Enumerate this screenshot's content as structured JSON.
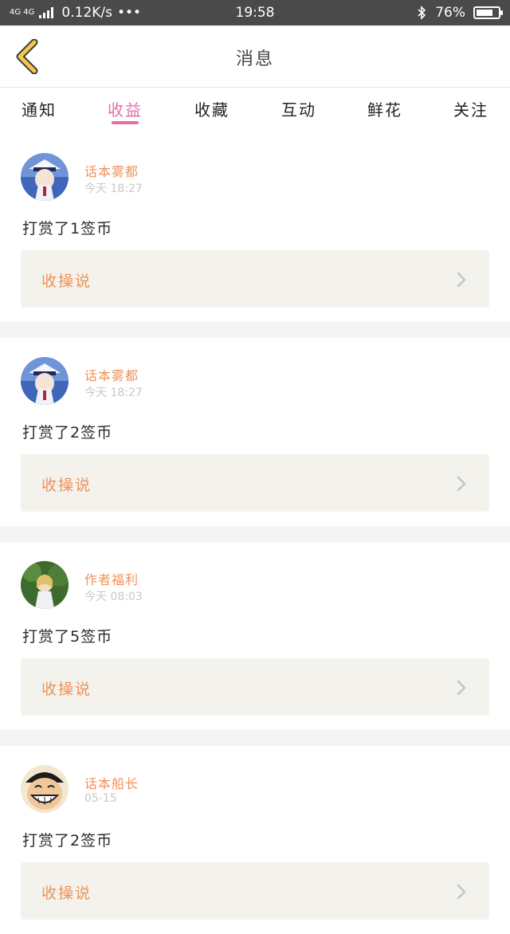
{
  "status_bar": {
    "network": "4G 4G",
    "speed": "0.12K/s",
    "dots": "•••",
    "time": "19:58",
    "bluetooth_icon": "bluetooth-icon",
    "battery_text": "76%",
    "battery_level": 0.76
  },
  "header": {
    "title": "消息",
    "back_icon": "chevron-left-icon",
    "accent": "#f2c94c"
  },
  "tabs": [
    {
      "label": "通知"
    },
    {
      "label": "收益"
    },
    {
      "label": "收藏"
    },
    {
      "label": "互动"
    },
    {
      "label": "鲜花"
    },
    {
      "label": "关注"
    }
  ],
  "active_tab": "收益",
  "colors": {
    "accent_pink": "#e070a6",
    "author_orange": "#f0925a",
    "link_bg": "#f3f2ec"
  },
  "items": [
    {
      "author": "话本雾都",
      "time": "今天 18:27",
      "message": "打赏了1签币",
      "link": "收操说",
      "avatar": "anime-avatar-blue"
    },
    {
      "author": "话本雾都",
      "time": "今天 18:27",
      "message": "打赏了2签币",
      "link": "收操说",
      "avatar": "anime-avatar-blue"
    },
    {
      "author": "作者福利",
      "time": "今天 08:03",
      "message": "打赏了5签币",
      "link": "收操说",
      "avatar": "anime-avatar-green"
    },
    {
      "author": "话本船长",
      "time": "05-15",
      "message": "打赏了2签币",
      "link": "收操说",
      "avatar": "cartoon-avatar-smile"
    }
  ]
}
